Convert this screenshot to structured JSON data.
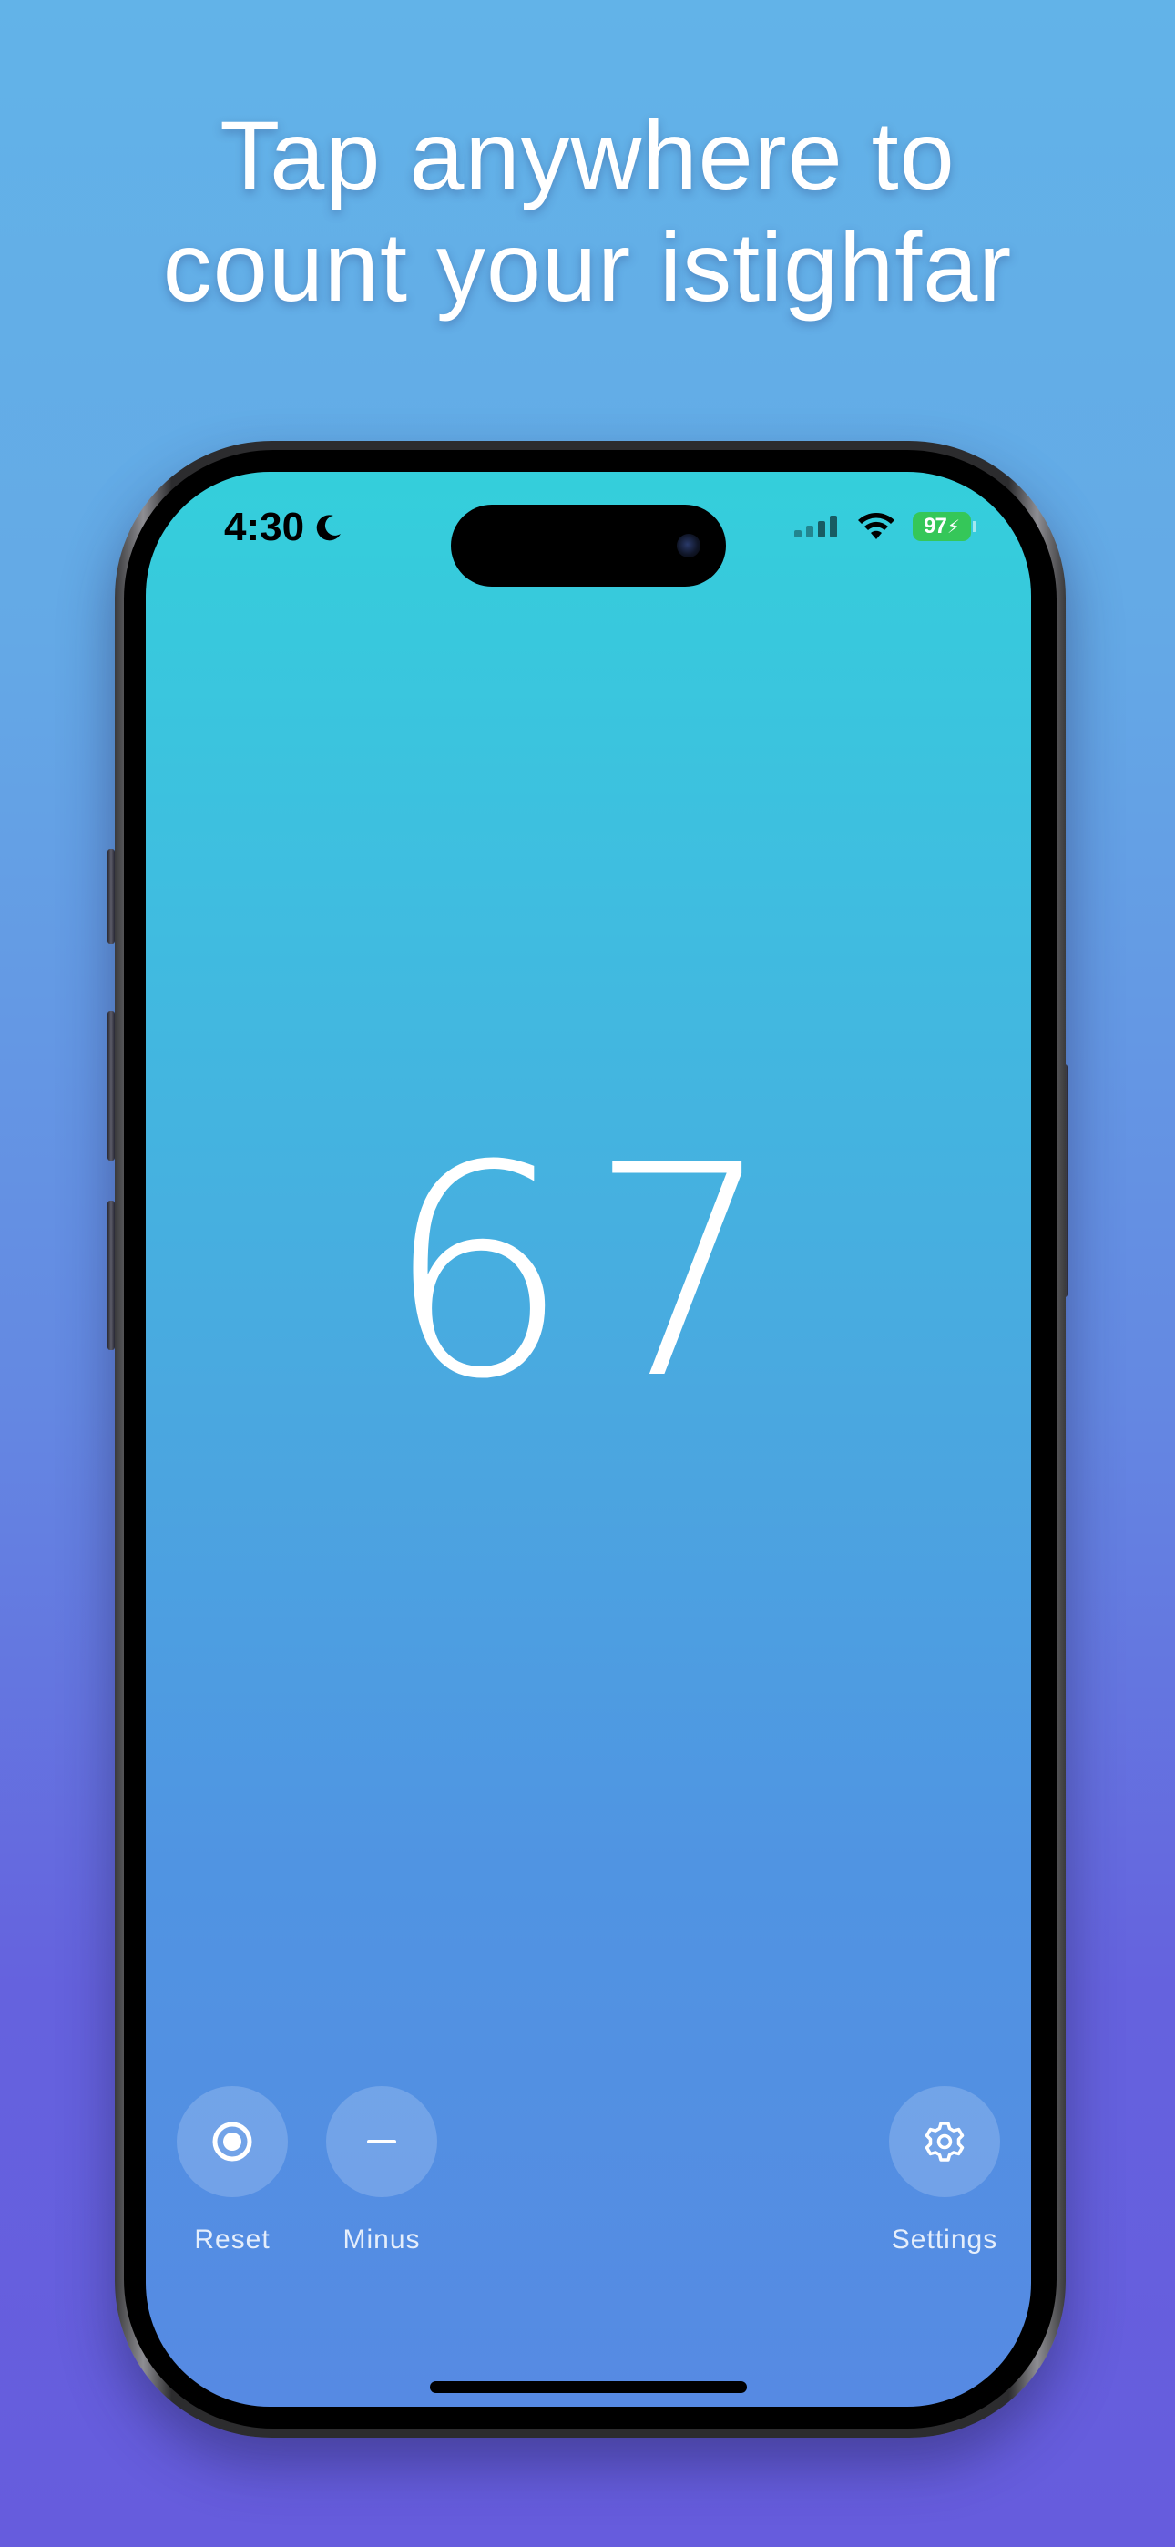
{
  "headline": {
    "line1": "Tap anywhere to",
    "line2": "count your istighfar"
  },
  "status_bar": {
    "time": "4:30",
    "battery": "97",
    "icons": [
      "moon-icon",
      "signal-icon",
      "wifi-icon",
      "battery-icon"
    ]
  },
  "counter": {
    "value": "67"
  },
  "controls": {
    "reset_label": "Reset",
    "minus_label": "Minus",
    "settings_label": "Settings"
  },
  "colors": {
    "background_top": "#62b3e8",
    "background_bottom": "#665cdd",
    "screen_top": "#34cfdb",
    "screen_bottom": "#568ae3",
    "battery": "#35c759"
  }
}
